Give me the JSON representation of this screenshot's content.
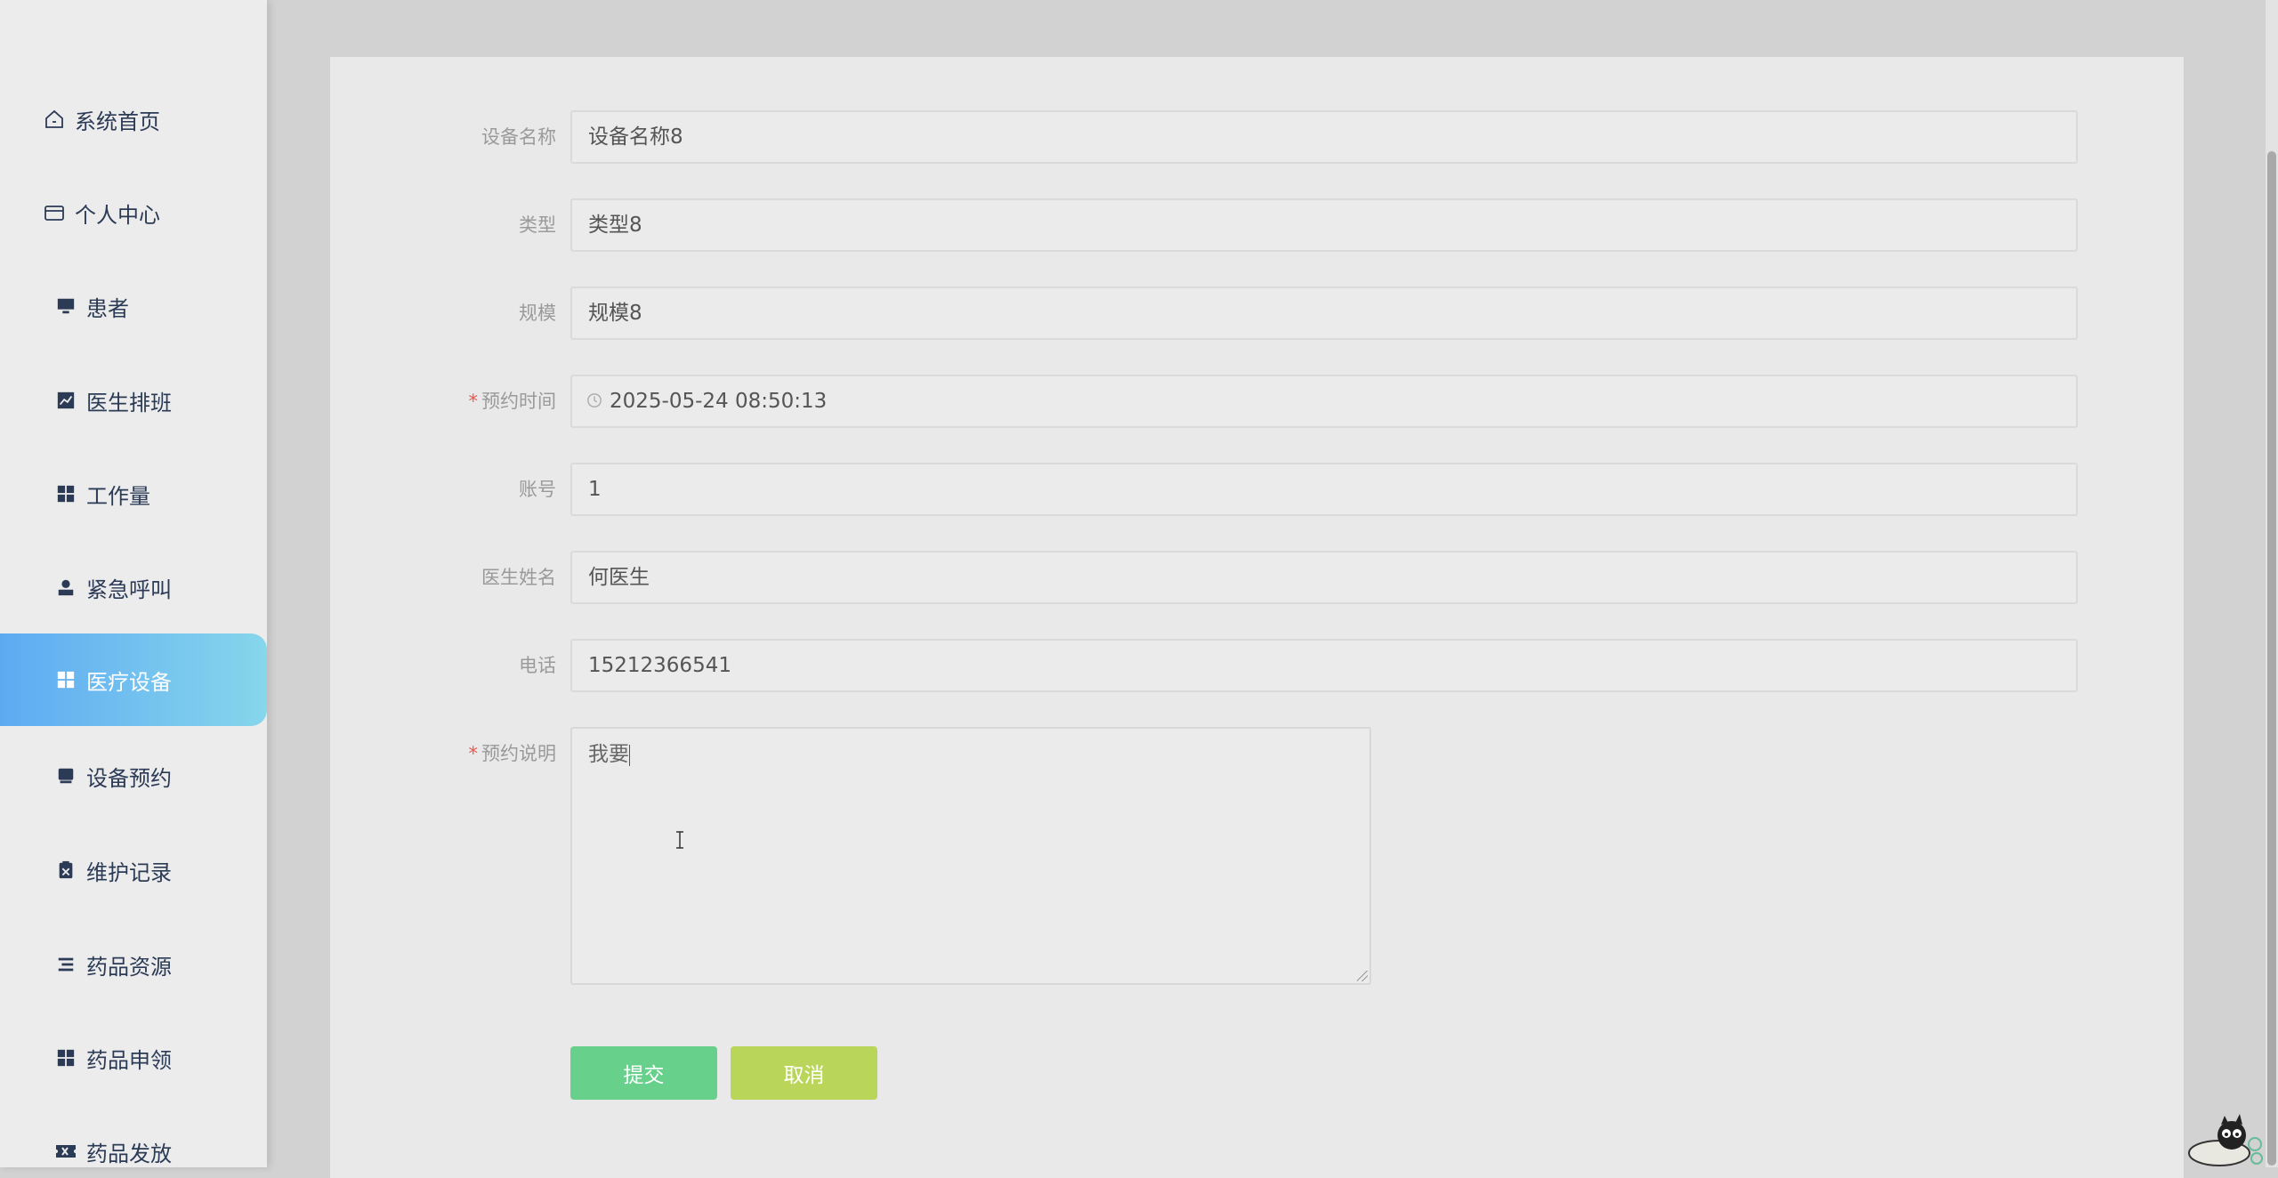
{
  "sidebar": {
    "items": [
      {
        "label": "系统首页",
        "icon": "home-icon"
      },
      {
        "label": "个人中心",
        "icon": "wallet-icon"
      },
      {
        "label": "患者",
        "icon": "monitor-icon"
      },
      {
        "label": "医生排班",
        "icon": "chart-icon"
      },
      {
        "label": "工作量",
        "icon": "grid-icon"
      },
      {
        "label": "紧急呼叫",
        "icon": "user-icon"
      },
      {
        "label": "医疗设备",
        "icon": "grid-icon",
        "active": true
      },
      {
        "label": "设备预约",
        "icon": "tray-icon"
      },
      {
        "label": "维护记录",
        "icon": "clipboard-icon"
      },
      {
        "label": "药品资源",
        "icon": "list-icon"
      },
      {
        "label": "药品申领",
        "icon": "grid-icon"
      },
      {
        "label": "药品发放",
        "icon": "ticket-icon"
      }
    ]
  },
  "form": {
    "fields": [
      {
        "label": "设备名称",
        "value": "设备名称8",
        "required": false
      },
      {
        "label": "类型",
        "value": "类型8",
        "required": false
      },
      {
        "label": "规模",
        "value": "规模8",
        "required": false
      },
      {
        "label": "预约时间",
        "value": "2025-05-24 08:50:13",
        "required": true,
        "icon": "clock-icon"
      },
      {
        "label": "账号",
        "value": "1",
        "required": false
      },
      {
        "label": "医生姓名",
        "value": "何医生",
        "required": false
      },
      {
        "label": "电话",
        "value": "15212366541",
        "required": false
      }
    ],
    "description": {
      "label": "预约说明",
      "value": "我要",
      "required": true
    },
    "required_mark": "*",
    "submit_label": "提交",
    "cancel_label": "取消"
  },
  "colors": {
    "active_gradient_start": "#5eaaf2",
    "active_gradient_end": "#86d6ec",
    "submit_button": "#67d18c",
    "cancel_button": "#b9d65a",
    "required_mark": "#e8584e"
  }
}
